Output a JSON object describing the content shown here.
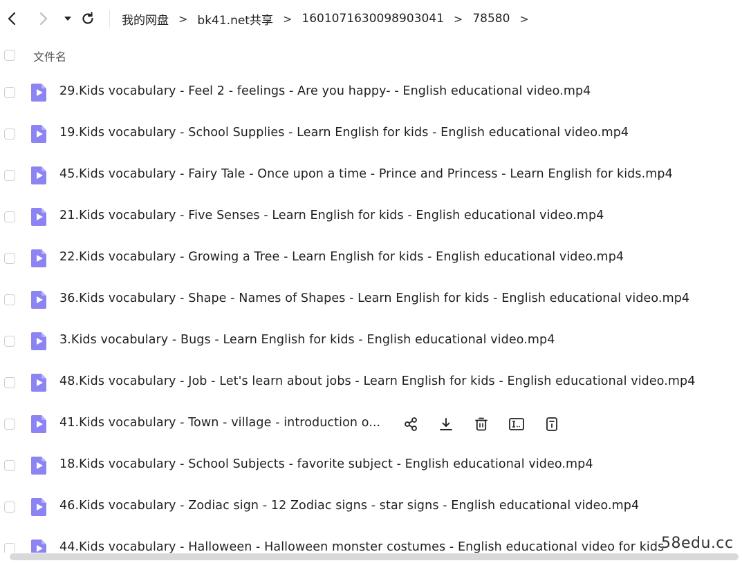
{
  "nav": {
    "breadcrumbs": [
      "我的网盘",
      "bk41.net共享",
      "1601071630098903041",
      "78580"
    ],
    "separator": ">"
  },
  "list": {
    "header_label": "文件名",
    "files": [
      {
        "name": "29.Kids vocabulary - Feel 2 - feelings - Are you happy- - English educational video.mp4"
      },
      {
        "name": "19.Kids vocabulary - School Supplies - Learn English for kids - English educational video.mp4"
      },
      {
        "name": "45.Kids vocabulary - Fairy Tale - Once upon a time - Prince and Princess - Learn English for kids.mp4"
      },
      {
        "name": "21.Kids vocabulary - Five Senses - Learn English for kids - English educational video.mp4"
      },
      {
        "name": "22.Kids vocabulary - Growing a Tree - Learn English for kids - English educational video.mp4"
      },
      {
        "name": "36.Kids vocabulary - Shape - Names of Shapes - Learn English for kids - English educational video.mp4"
      },
      {
        "name": "3.Kids vocabulary - Bugs - Learn English for kids - English educational video.mp4"
      },
      {
        "name": "48.Kids vocabulary - Job - Let's learn about jobs - Learn English for kids - English educational video.mp4"
      },
      {
        "name": "41.Kids vocabulary - Town - village - introduction o..."
      },
      {
        "name": "18.Kids vocabulary - School Subjects - favorite subject - English educational video.mp4"
      },
      {
        "name": "46.Kids vocabulary - Zodiac sign - 12 Zodiac signs - star signs - English educational video.mp4"
      },
      {
        "name": "44.Kids vocabulary - Halloween - Halloween monster costumes - English educational video for kids"
      }
    ],
    "hovered_index": 8
  },
  "row_action_icons": [
    "share-icon",
    "download-icon",
    "delete-icon",
    "rename-icon",
    "details-icon"
  ],
  "watermark": "58edu.cc",
  "colors": {
    "video_icon": "#8b84f2",
    "video_icon_light": "#b7b2f8",
    "text": "#1f1f1f",
    "checkbox_border": "#cfcfcf"
  }
}
